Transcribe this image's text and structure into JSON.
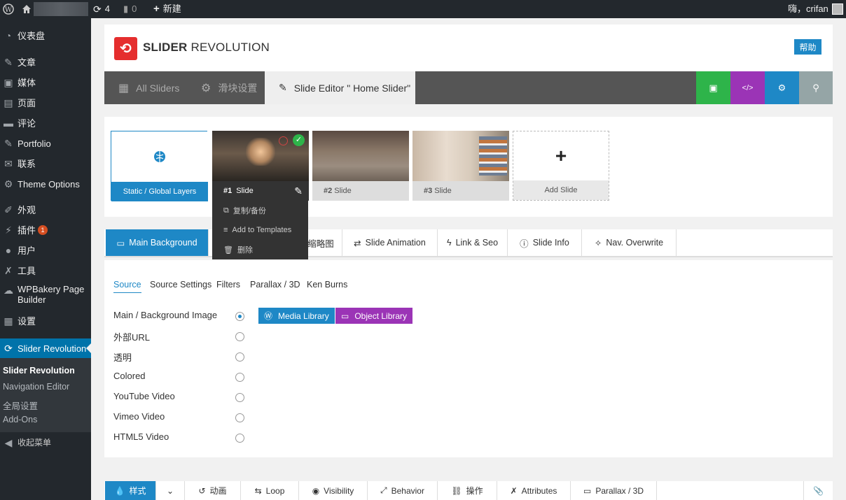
{
  "adminbar": {
    "updates_count": "4",
    "comments_count": "0",
    "new_label": "新建",
    "greeting": "嗨，crifan"
  },
  "sidebar": {
    "items": [
      {
        "icon": "gauge-icon",
        "label": "仪表盘"
      },
      {
        "icon": "pin-icon",
        "label": "文章"
      },
      {
        "icon": "media-icon",
        "label": "媒体"
      },
      {
        "icon": "page-icon",
        "label": "页面"
      },
      {
        "icon": "comment-icon",
        "label": "评论"
      },
      {
        "icon": "pin-icon",
        "label": "Portfolio"
      },
      {
        "icon": "mail-icon",
        "label": "联系"
      },
      {
        "icon": "gear-icon",
        "label": "Theme Options"
      },
      {
        "icon": "brush-icon",
        "label": "外观"
      },
      {
        "icon": "plugin-icon",
        "label": "插件",
        "badge": "1"
      },
      {
        "icon": "user-icon",
        "label": "用户"
      },
      {
        "icon": "wrench-icon",
        "label": "工具"
      },
      {
        "icon": "cloud-icon",
        "label": "WPBakery Page Builder"
      },
      {
        "icon": "settings-icon",
        "label": "设置"
      },
      {
        "icon": "refresh-icon",
        "label": "Slider Revolution"
      }
    ],
    "submenu": [
      "Slider Revolution",
      "Navigation Editor",
      "全局设置",
      "Add-Ons"
    ],
    "collapse_label": "收起菜单"
  },
  "header": {
    "logo_bold": "SLIDER",
    "logo_light": "REVOLUTION",
    "help_label": "帮助"
  },
  "toolbar": {
    "tabs": [
      "All Sliders",
      "滑块设置",
      "Slide Editor \" Home Slider\""
    ],
    "colors": {
      "save": "#2eb44a",
      "code": "#9b34b6",
      "settings": "#1e88c6",
      "search": "#95a5a6"
    }
  },
  "slides": {
    "static_label": "Static / Global Layers",
    "cards": [
      {
        "num": "#1",
        "label": "Slide"
      },
      {
        "num": "#2",
        "label": "Slide"
      },
      {
        "num": "#3",
        "label": "Slide"
      }
    ],
    "add_label": "Add Slide",
    "menu": [
      "复制/备份",
      "Add to Templates",
      "删除"
    ]
  },
  "tabs": [
    "Main Background",
    "缩略图",
    "Slide Animation",
    "Link & Seo",
    "Slide Info",
    "Nav. Overwrite"
  ],
  "content": {
    "subtabs": [
      "Source",
      "Source Settings",
      "Filters",
      "Parallax / 3D",
      "Ken Burns"
    ],
    "sources": [
      "Main / Background Image",
      "外部URL",
      "透明",
      "Colored",
      "YouTube Video",
      "Vimeo Video",
      "HTML5 Video"
    ],
    "media_library_label": "Media Library",
    "object_library_label": "Object Library"
  },
  "bottom_bar": [
    "样式",
    "动画",
    "Loop",
    "Visibility",
    "Behavior",
    "操作",
    "Attributes",
    "Parallax / 3D"
  ]
}
